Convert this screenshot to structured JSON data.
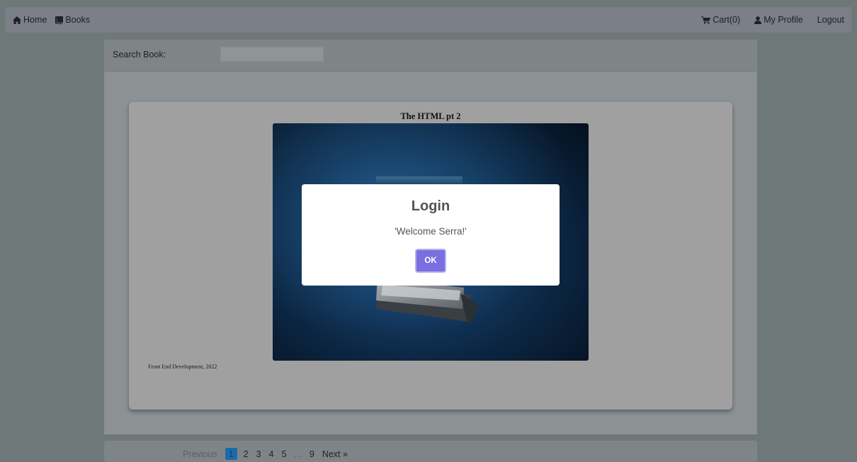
{
  "navbar": {
    "home_label": "Home",
    "books_label": "Books",
    "cart_label": "Cart(0)",
    "profile_label": "My Profile",
    "logout_label": "Logout"
  },
  "search": {
    "label": "Search Book:",
    "value": "",
    "placeholder": ""
  },
  "book": {
    "title": "The HTML pt 2",
    "footnote": "Front End Development, 2022"
  },
  "pagination": {
    "items": [
      "Previous",
      "1",
      "2",
      "3",
      "4",
      "5",
      "...",
      "9",
      "Next »"
    ],
    "active": "1"
  },
  "modal": {
    "title": "Login",
    "message": "'Welcome Serra!'",
    "ok_label": "OK"
  },
  "colors": {
    "accent": "#7a6fe0",
    "active_page": "#1a6ca8"
  }
}
